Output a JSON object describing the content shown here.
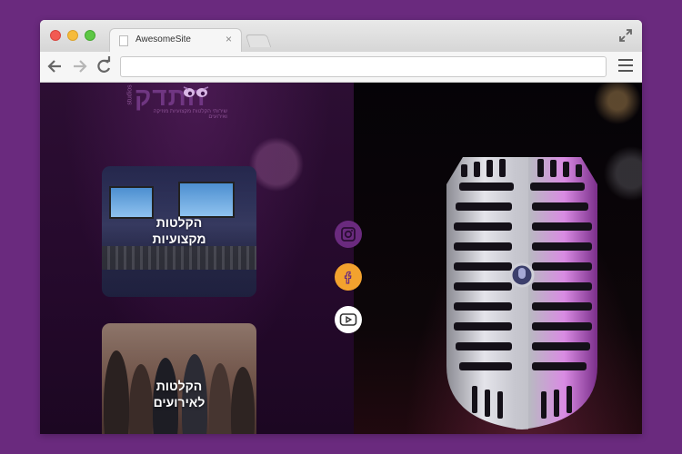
{
  "browser": {
    "tab_title": "AwesomeSite",
    "tab_close": "×",
    "url": ""
  },
  "logo": {
    "hebrew": "חתדק",
    "studios": "studios",
    "tagline": "שירותי הקלטות מקצועיות מוזיקה ואירועים"
  },
  "cards": [
    {
      "title_line1": "הקלטות",
      "title_line2": "מקצועיות"
    },
    {
      "title_line1": "הקלטות",
      "title_line2": "לאירועים"
    }
  ],
  "social": [
    {
      "icon": "instagram-icon",
      "color": "#6a2a7e"
    },
    {
      "icon": "facebook-icon",
      "color": "#f3a22e"
    },
    {
      "icon": "youtube-icon",
      "color": "#ffffff"
    }
  ],
  "colors": {
    "page_background": "#6a2a7e",
    "accent_purple": "#6a2a7e",
    "accent_orange": "#f3a22e"
  }
}
